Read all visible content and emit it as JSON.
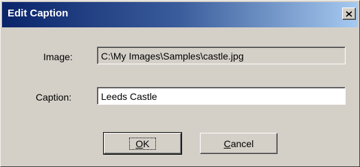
{
  "window": {
    "title": "Edit Caption",
    "close_icon": "close-icon"
  },
  "form": {
    "image_label": "Image:",
    "image_value": "C:\\My Images\\Samples\\castle.jpg",
    "caption_label": "Caption:",
    "caption_value": "Leeds Castle"
  },
  "buttons": {
    "ok": {
      "accel": "O",
      "rest": "K"
    },
    "cancel": {
      "accel": "C",
      "rest": "ancel"
    }
  },
  "colors": {
    "face": "#d4d0c8",
    "title_start": "#0a246a",
    "title_end": "#a6caf0"
  }
}
